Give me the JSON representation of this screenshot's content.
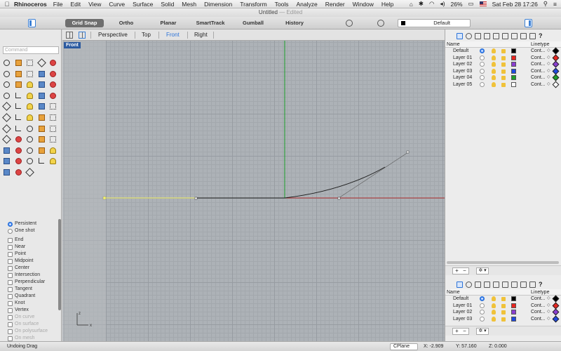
{
  "menubar": {
    "app_name": "Rhinoceros",
    "items": [
      "File",
      "Edit",
      "View",
      "Curve",
      "Surface",
      "Solid",
      "Mesh",
      "Dimension",
      "Transform",
      "Tools",
      "Analyze",
      "Render",
      "Window",
      "Help"
    ],
    "battery": "26%",
    "clock": "Sat Feb 28  17:26"
  },
  "window": {
    "title": "Untitled",
    "status": "Edited"
  },
  "toolbar": {
    "modes": [
      "Grid Snap",
      "Ortho",
      "Planar",
      "SmartTrack",
      "Gumball",
      "History"
    ],
    "current_layer": "Default"
  },
  "command": {
    "placeholder": "Command"
  },
  "tools": {
    "icons": [
      "select-arrow-icon",
      "point-icon",
      "polyline-icon",
      "curve-icon",
      "circle-icon",
      "ellipse-icon",
      "arc-icon",
      "rectangle-icon",
      "polygon-icon",
      "freeform-icon",
      "surface-icon",
      "box-icon",
      "sphere-icon",
      "cylinder-icon",
      "mesh-icon",
      "boolean-icon",
      "fillet-icon",
      "trim-icon",
      "split-icon",
      "join-icon",
      "explode-icon",
      "rebuild-icon",
      "offset-icon",
      "extend-icon",
      "array-icon",
      "mirror-icon",
      "move-icon",
      "rotate-icon",
      "scale-icon",
      "copy-icon",
      "group-icon",
      "layer-icon",
      "properties-icon",
      "check-icon",
      "dimension-icon",
      "text-icon",
      "hatch-icon",
      "analyze-icon",
      "zoom-icon",
      "pan-icon",
      "view-icon",
      "camera-icon",
      "render-icon",
      "material-icon",
      "light-icon",
      "print-icon",
      "export-icon",
      "color-icon",
      "display-icon",
      "snap-icon",
      "globe-icon",
      "script-icon",
      "history-icon"
    ]
  },
  "osnap": {
    "mode_options": [
      {
        "label": "Persistent",
        "selected": true
      },
      {
        "label": "One shot",
        "selected": false
      }
    ],
    "snaps": [
      {
        "label": "End",
        "enabled": true
      },
      {
        "label": "Near",
        "enabled": true
      },
      {
        "label": "Point",
        "enabled": true
      },
      {
        "label": "Midpoint",
        "enabled": true
      },
      {
        "label": "Center",
        "enabled": true
      },
      {
        "label": "Intersection",
        "enabled": true
      },
      {
        "label": "Perpendicular",
        "enabled": true
      },
      {
        "label": "Tangent",
        "enabled": true
      },
      {
        "label": "Quadrant",
        "enabled": true
      },
      {
        "label": "Knot",
        "enabled": true
      },
      {
        "label": "Vertex",
        "enabled": true
      },
      {
        "label": "On curve",
        "enabled": false
      },
      {
        "label": "On surface",
        "enabled": false
      },
      {
        "label": "On polysurface",
        "enabled": false
      },
      {
        "label": "On mesh",
        "enabled": false
      }
    ]
  },
  "viewport": {
    "tabs": [
      "Perspective",
      "Top",
      "Front",
      "Right"
    ],
    "active_tab": "Front",
    "label": "Front",
    "axis_x": "x",
    "axis_z": "z"
  },
  "layers_panel": {
    "col_name": "Name",
    "col_linetype": "Linetype",
    "layers": [
      {
        "name": "Default",
        "current": true,
        "color": "#000000",
        "linetype": "Cont...",
        "material": "#000000"
      },
      {
        "name": "Layer 01",
        "current": false,
        "color": "#e8251f",
        "linetype": "Cont...",
        "material": "#e8251f"
      },
      {
        "name": "Layer 02",
        "current": false,
        "color": "#8a3fd1",
        "linetype": "Cont...",
        "material": "#8a3fd1"
      },
      {
        "name": "Layer 03",
        "current": false,
        "color": "#1f49e0",
        "linetype": "Cont...",
        "material": "#1f49e0"
      },
      {
        "name": "Layer 04",
        "current": false,
        "color": "#1f9e2a",
        "linetype": "Cont...",
        "material": "#1f9e2a"
      },
      {
        "name": "Layer 05",
        "current": false,
        "color": "#ffffff",
        "linetype": "Cont...",
        "material": "#ffffff"
      }
    ],
    "layers_lower": [
      {
        "name": "Default",
        "current": true,
        "color": "#000000",
        "linetype": "Cont...",
        "material": "#000000"
      },
      {
        "name": "Layer 01",
        "current": false,
        "color": "#e8251f",
        "linetype": "Cont...",
        "material": "#e8251f"
      },
      {
        "name": "Layer 02",
        "current": false,
        "color": "#8a3fd1",
        "linetype": "Cont...",
        "material": "#8a3fd1"
      },
      {
        "name": "Layer 03",
        "current": false,
        "color": "#1f49e0",
        "linetype": "Cont...",
        "material": "#1f49e0"
      }
    ],
    "plus": "+",
    "minus": "−",
    "gear": "✲ ▾"
  },
  "statusbar": {
    "message": "Undoing Drag",
    "cplane": "CPlane",
    "x": "X: -2.909",
    "y": "Y: 57.160",
    "z": "Z: 0.000"
  }
}
